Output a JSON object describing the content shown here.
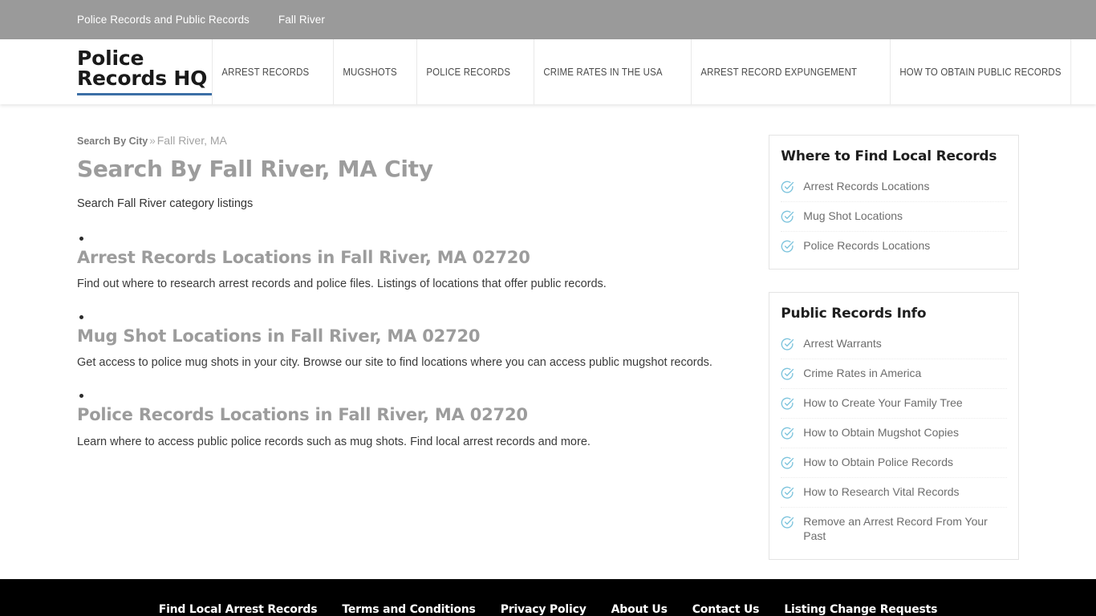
{
  "topbar": {
    "tagline": "Police Records and Public Records",
    "city": "Fall River"
  },
  "header": {
    "logo": "Police Records HQ",
    "accent_color": "#3c6fa6",
    "nav": [
      {
        "label": "ARREST RECORDS"
      },
      {
        "label": "MUGSHOTS"
      },
      {
        "label": "POLICE RECORDS"
      },
      {
        "label": "CRIME RATES IN THE USA"
      },
      {
        "label": "ARREST RECORD EXPUNGEMENT"
      },
      {
        "label": "HOW TO OBTAIN PUBLIC RECORDS"
      }
    ]
  },
  "breadcrumb": {
    "parent": "Search By City",
    "separator": "»",
    "current": "Fall River, MA"
  },
  "main": {
    "title": "Search By Fall River, MA City",
    "intro": "Search Fall River category listings",
    "entries": [
      {
        "heading": "Arrest Records Locations in Fall River, MA 02720",
        "description": "Find out where to research arrest records and police files. Listings of locations that offer public records."
      },
      {
        "heading": "Mug Shot Locations in Fall River, MA 02720",
        "description": "Get access to police mug shots in your city. Browse our site to find locations where you can access public mugshot records."
      },
      {
        "heading": "Police Records Locations in Fall River, MA 02720",
        "description": "Learn where to access public police records such as mug shots. Find local arrest records and more."
      }
    ]
  },
  "sidebar": {
    "icon_color": "#7dc4dd",
    "widgets": [
      {
        "title": "Where to Find Local Records",
        "items": [
          {
            "label": "Arrest Records Locations"
          },
          {
            "label": "Mug Shot Locations"
          },
          {
            "label": "Police Records Locations"
          }
        ]
      },
      {
        "title": "Public Records Info",
        "items": [
          {
            "label": "Arrest Warrants"
          },
          {
            "label": "Crime Rates in America"
          },
          {
            "label": "How to Create Your Family Tree"
          },
          {
            "label": "How to Obtain Mugshot Copies"
          },
          {
            "label": "How to Obtain Police Records"
          },
          {
            "label": "How to Research Vital Records"
          },
          {
            "label": "Remove an Arrest Record From Your Past"
          }
        ]
      }
    ]
  },
  "footer": {
    "links": [
      {
        "label": "Find Local Arrest Records"
      },
      {
        "label": "Terms and Conditions"
      },
      {
        "label": "Privacy Policy"
      },
      {
        "label": "About Us"
      },
      {
        "label": "Contact Us"
      },
      {
        "label": "Listing Change Requests"
      }
    ]
  }
}
